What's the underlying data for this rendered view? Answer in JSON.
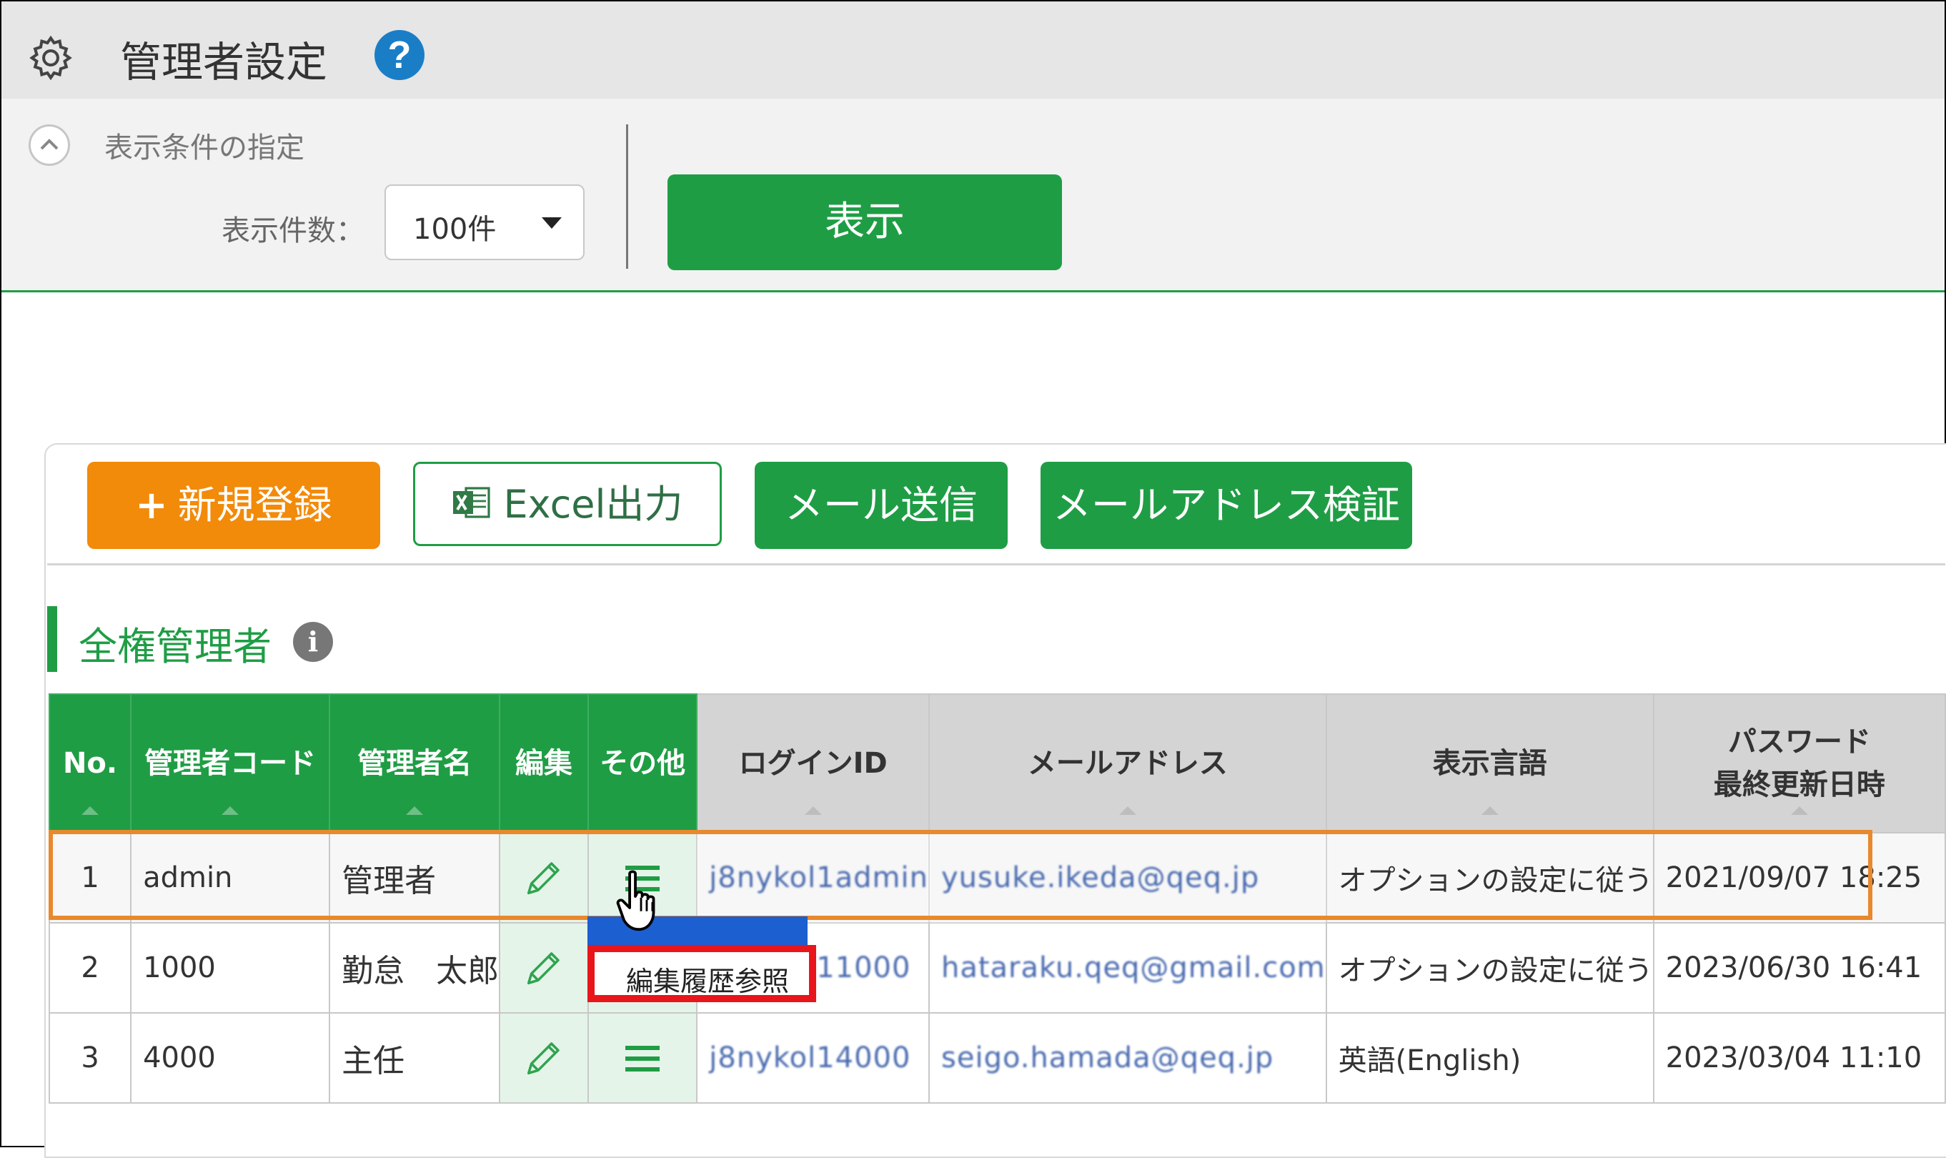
{
  "header": {
    "title": "管理者設定",
    "help_label": "?"
  },
  "filter": {
    "caption": "表示条件の指定",
    "count_label": "表示件数：",
    "count_value": "100件",
    "show_button": "表示"
  },
  "toolbar": {
    "new_plus": "+",
    "new_label": "新規登録",
    "excel_label": "Excel出力",
    "mail_label": "メール送信",
    "verify_label": "メールアドレス検証"
  },
  "section": {
    "title": "全権管理者",
    "info_label": "i"
  },
  "table": {
    "headers": {
      "no": "No.",
      "code": "管理者コード",
      "name": "管理者名",
      "edit": "編集",
      "other": "その他",
      "login": "ログインID",
      "mail": "メールアドレス",
      "lang": "表示言語",
      "pw_line1": "パスワード",
      "pw_line2": "最終更新日時"
    },
    "rows": [
      {
        "no": "1",
        "code": "admin",
        "name": "管理者",
        "login": "j8nykol1admin",
        "mail": "yusuke.ikeda@qeq.jp",
        "lang": "オプションの設定に従う",
        "updated": "2021/09/07 18:25"
      },
      {
        "no": "2",
        "code": "1000",
        "name": "勤怠　太郎",
        "login": "j8nykol11000",
        "mail": "hataraku.qeq@gmail.com",
        "lang": "オプションの設定に従う",
        "updated": "2023/06/30 16:41"
      },
      {
        "no": "3",
        "code": "4000",
        "name": "主任",
        "login": "j8nykol14000",
        "mail": "seigo.hamada@qeq.jp",
        "lang": "英語(English)",
        "updated": "2023/03/04 11:10"
      }
    ]
  },
  "popup": {
    "item_label": "編集履歴参照"
  },
  "colors": {
    "brand_green": "#1f9d45",
    "new_orange": "#f28a0a",
    "highlight_red": "#e8151b",
    "selection_orange": "#e8892d"
  },
  "icons": [
    "gear-icon",
    "help-icon",
    "chevron-up-icon",
    "excel-icon",
    "info-icon",
    "pencil-icon",
    "menu-lines-icon",
    "hand-cursor-icon"
  ]
}
